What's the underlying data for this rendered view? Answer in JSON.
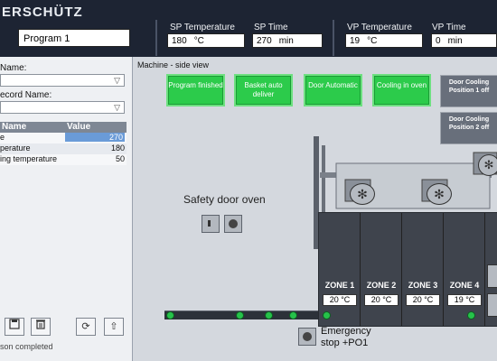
{
  "header": {
    "brand": "ERSCHÜTZ",
    "program": "Program 1",
    "params": [
      {
        "label": "SP Temperature",
        "value": "180",
        "unit": "°C"
      },
      {
        "label": "SP Time",
        "value": "270",
        "unit": "min"
      },
      {
        "label": "VP Temperature",
        "value": "19",
        "unit": "°C"
      },
      {
        "label": "VP Time",
        "value": "0",
        "unit": "min"
      }
    ]
  },
  "left": {
    "name_label": "Name:",
    "record_label": "ecord Name:",
    "table": {
      "headers": [
        "Name",
        "Value"
      ],
      "rows": [
        {
          "name": "e",
          "value": "270"
        },
        {
          "name": "perature",
          "value": "180"
        },
        {
          "name": "ing temperature",
          "value": "50"
        }
      ]
    },
    "status": "son completed"
  },
  "main": {
    "title": "Machine - side view",
    "buttons": [
      "Program finished",
      "Basket auto deliver",
      "Door Automatic",
      "Cooling in oven"
    ],
    "cooling_pos": [
      "Door Cooling Position 1 off",
      "Door Cooling Position 2 off"
    ],
    "safety_door": "Safety door oven",
    "zones": [
      {
        "label": "ZONE 1",
        "value": "20 °C"
      },
      {
        "label": "ZONE 2",
        "value": "20 °C"
      },
      {
        "label": "ZONE 3",
        "value": "20 °C"
      },
      {
        "label": "ZONE 4",
        "value": "19 °C"
      }
    ],
    "emergency_line1": "Emergency",
    "emergency_line2": "stop +PO1"
  },
  "colors": {
    "header_bg": "#1d2433",
    "green": "#2ccb4b",
    "panel_gray": "#686f7b",
    "accent_blue": "#6a9bd8"
  },
  "icons": [
    "chevron-down-icon",
    "save-icon",
    "trash-icon",
    "refresh-icon",
    "upload-icon",
    "square-button-icon",
    "round-button-icon",
    "fan-icon"
  ]
}
